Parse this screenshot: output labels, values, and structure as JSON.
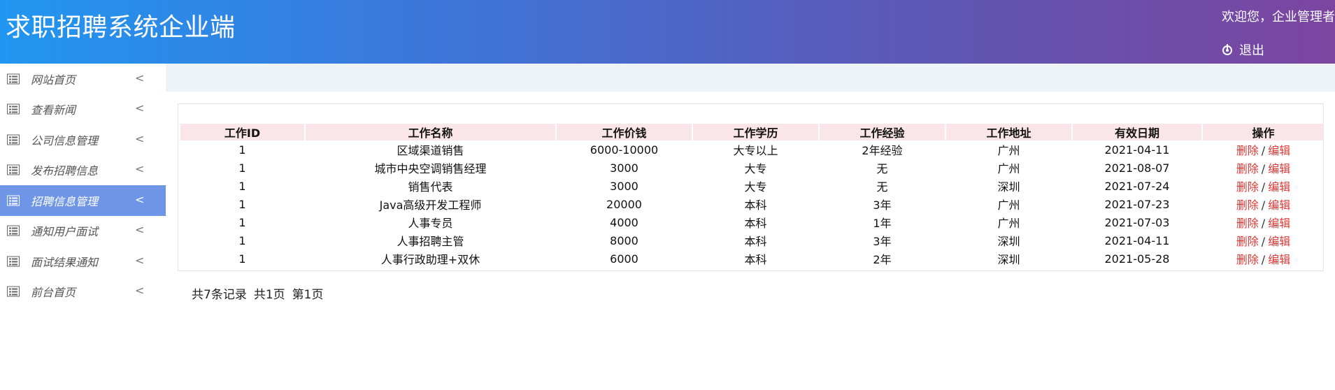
{
  "header": {
    "app_title": "求职招聘系统企业端",
    "welcome_text": "欢迎您，企业管理者",
    "logout_label": "退出"
  },
  "sidebar": {
    "items": [
      {
        "label": "网站首页",
        "icon": "table-icon",
        "active": false
      },
      {
        "label": "查看新闻",
        "icon": "table-icon",
        "active": false
      },
      {
        "label": "公司信息管理",
        "icon": "table-icon",
        "active": false
      },
      {
        "label": "发布招聘信息",
        "icon": "table-icon",
        "active": false
      },
      {
        "label": "招聘信息管理",
        "icon": "table-icon",
        "active": true
      },
      {
        "label": "通知用户面试",
        "icon": "table-icon",
        "active": false
      },
      {
        "label": "面试结果通知",
        "icon": "table-icon",
        "active": false
      },
      {
        "label": "前台首页",
        "icon": "table-icon",
        "active": false
      }
    ],
    "chevron": "<"
  },
  "table": {
    "headers": [
      "工作ID",
      "工作名称",
      "工作价钱",
      "工作学历",
      "工作经验",
      "工作地址",
      "有效日期",
      "操作"
    ],
    "rows": [
      {
        "id": "1",
        "name": "区域渠道销售",
        "price": "6000-10000",
        "edu": "大专以上",
        "exp": "2年经验",
        "addr": "广州",
        "date": "2021-04-11"
      },
      {
        "id": "1",
        "name": "城市中央空调销售经理",
        "price": "3000",
        "edu": "大专",
        "exp": "无",
        "addr": "广州",
        "date": "2021-08-07"
      },
      {
        "id": "1",
        "name": "销售代表",
        "price": "3000",
        "edu": "大专",
        "exp": "无",
        "addr": "深圳",
        "date": "2021-07-24"
      },
      {
        "id": "1",
        "name": "Java高级开发工程师",
        "price": "20000",
        "edu": "本科",
        "exp": "3年",
        "addr": "广州",
        "date": "2021-07-23"
      },
      {
        "id": "1",
        "name": "人事专员",
        "price": "4000",
        "edu": "本科",
        "exp": "1年",
        "addr": "广州",
        "date": "2021-07-03"
      },
      {
        "id": "1",
        "name": "人事招聘主管",
        "price": "8000",
        "edu": "本科",
        "exp": "3年",
        "addr": "深圳",
        "date": "2021-04-11"
      },
      {
        "id": "1",
        "name": "人事行政助理+双休",
        "price": "6000",
        "edu": "本科",
        "exp": "2年",
        "addr": "深圳",
        "date": "2021-05-28"
      }
    ],
    "actions": {
      "delete": "删除",
      "separator": "/",
      "edit": "编辑"
    }
  },
  "pagination": {
    "total_records": "共7条记录",
    "total_pages": "共1页",
    "current_page": "第1页"
  },
  "colors": {
    "header_gradient_start": "#2196f0",
    "header_gradient_end": "#7b45a0",
    "active_nav": "#6f96e6",
    "table_header_bg": "#fae6e8",
    "action_link": "#e53935"
  }
}
